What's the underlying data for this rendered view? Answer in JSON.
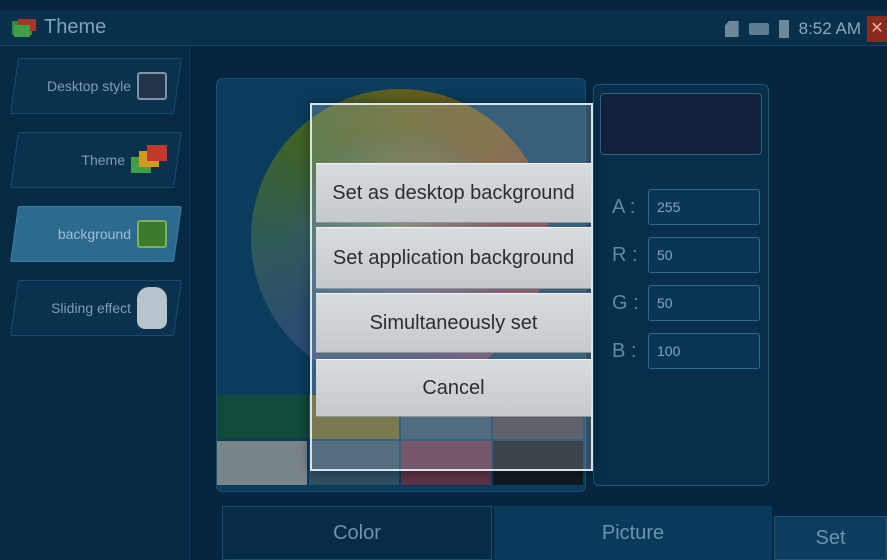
{
  "app": {
    "title": "Theme",
    "time": "8:52 AM"
  },
  "sidebar": {
    "items": [
      {
        "label": "Desktop style",
        "icon": "desktop-style-icon"
      },
      {
        "label": "Theme",
        "icon": "theme-icon"
      },
      {
        "label": "background",
        "icon": "background-icon",
        "active": true
      },
      {
        "label": "Sliding effect",
        "icon": "hand-icon"
      }
    ]
  },
  "color": {
    "channels": [
      {
        "label": "A :",
        "value": "255"
      },
      {
        "label": "R :",
        "value": "50"
      },
      {
        "label": "G :",
        "value": "50"
      },
      {
        "label": "B :",
        "value": "100"
      }
    ],
    "preview_color": "#12213c"
  },
  "tabs": {
    "color": "Color",
    "picture": "Picture",
    "set": "Set"
  },
  "dialog": {
    "buttons": [
      "Set as desktop background",
      "Set application background",
      "Simultaneously set",
      "Cancel"
    ]
  },
  "colors": {
    "accent": "#2d6a8f",
    "background": "#06263f"
  }
}
